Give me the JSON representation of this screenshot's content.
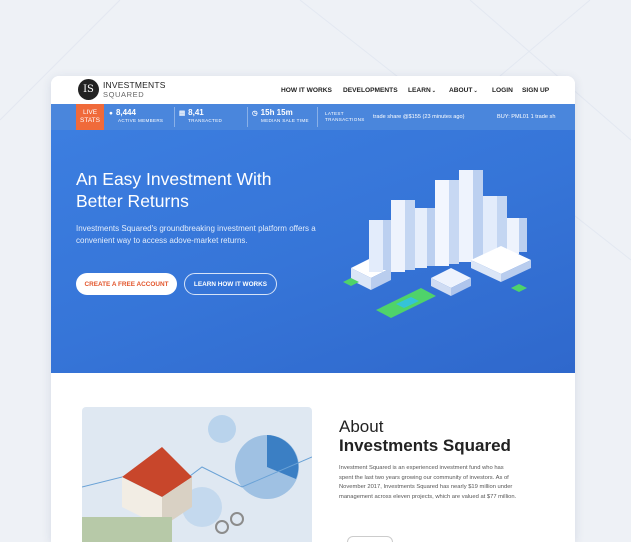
{
  "logo": {
    "mark": "IS",
    "line1": "INVESTMENTS",
    "line2": "SQUARED"
  },
  "nav": {
    "items": [
      {
        "label": "HOW IT WORKS",
        "dropdown": false
      },
      {
        "label": "DEVELOPMENTS",
        "dropdown": false
      },
      {
        "label": "LEARN",
        "dropdown": true
      },
      {
        "label": "ABOUT",
        "dropdown": true
      },
      {
        "label": "LOGIN",
        "dropdown": false
      },
      {
        "label": "SIGN UP",
        "dropdown": false
      }
    ]
  },
  "stats": {
    "live_line1": "LIVE",
    "live_line2": "STATS",
    "members": {
      "value": "8,444",
      "label": "ACTIVE MEMBERS",
      "icon": "user-icon"
    },
    "transacted": {
      "value": "8,41",
      "label": "TRANSACTED",
      "icon": "card-icon"
    },
    "median": {
      "value": "15h 15m",
      "label": "MEDIAN SALE TIME",
      "icon": "clock-icon"
    },
    "latest_line1": "LATEST",
    "latest_line2": "TRANSACTIONS",
    "ticker1": "trade share @$155 (23 minutes ago)",
    "ticker2": "BUY: PML01 1 trade sh"
  },
  "hero": {
    "title_line1": "An Easy Investment With",
    "title_line2": "Better Returns",
    "description": "Investments Squared's groundbreaking investment platform offers a convenient way to access adove-market returns.",
    "primary_button": "CREATE A FREE ACCOUNT",
    "secondary_button": "LEARN HOW IT WORKS"
  },
  "about": {
    "title_line1": "About",
    "title_line2": "Investments Squared",
    "text": "Investment Squared is an experienced investment fund who has spent the last two years growing our community of investors. As of November 2017, Investments Squared has nearly $19 million under management across eleven projects, which are valued at $77 million."
  },
  "colors": {
    "hero_blue": "#3c7ee0",
    "stats_blue": "#4a86dc",
    "live_orange": "#f06a3a",
    "cta_orange": "#e2552b"
  }
}
